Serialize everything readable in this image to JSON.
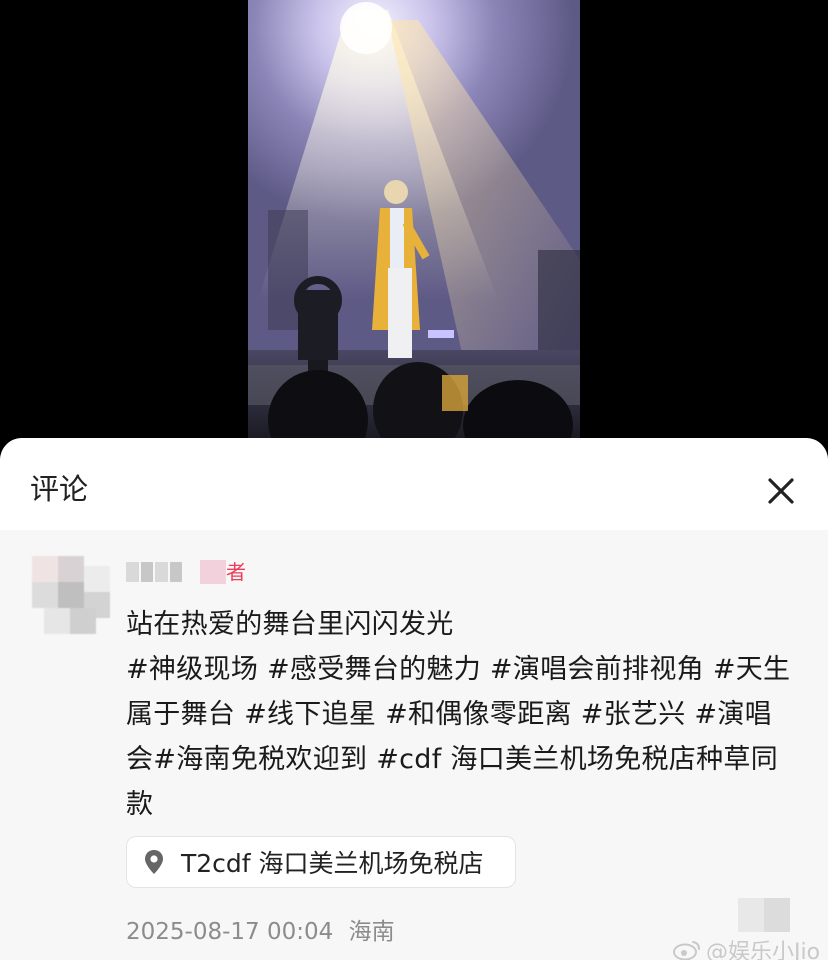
{
  "sheet": {
    "title": "评论",
    "close_icon": "close-icon"
  },
  "comment": {
    "author_badge": "者",
    "text_lines": [
      "站在热爱的舞台里闪闪发光",
      "#神级现场 #感受舞台的魅力 #演唱会前排视角 #天生",
      "属于舞台 #线下追星 #和偶像零距离 #张艺兴 #演唱",
      "会#海南免税欢迎到 #cdf 海口美兰机场免税店种草同",
      "款"
    ],
    "location": "T2cdf 海口美兰机场免税店",
    "location_icon": "location-pin-icon",
    "timestamp": "2025-08-17 00:04",
    "region": "海南"
  },
  "watermark": {
    "icon": "weibo-icon",
    "text": "@娱乐小Jio"
  },
  "colors": {
    "author_badge": "#ee3b5b",
    "sheet_background": "#f7f7f7",
    "meta_text": "#8c8c8c"
  }
}
